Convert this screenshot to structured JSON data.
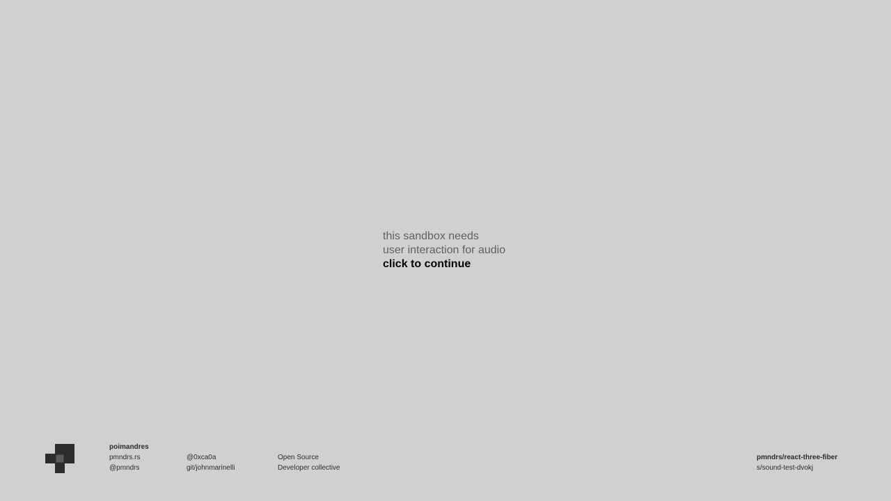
{
  "prompt": {
    "line1": "this sandbox needs",
    "line2": "user interaction for audio",
    "cta": "click to continue"
  },
  "footer": {
    "brand": {
      "name": "poimandres",
      "site": "pmndrs.rs",
      "handle": "@pmndrs"
    },
    "author": {
      "handle": "@0xca0a",
      "git": "git/johnmarinelli"
    },
    "about": {
      "line1": "Open Source",
      "line2": "Developer collective"
    },
    "project": {
      "repo": "pmndrs/react-three-fiber",
      "sandbox": "s/sound-test-dvokj"
    },
    "logo_icon": "pmndrs-logo-icon"
  },
  "colors": {
    "background": "#d0d0d0",
    "prompt_text": "#616161",
    "cta_text": "#000000",
    "footer_text": "#2c2c2c",
    "logo": "#2c2c2c"
  }
}
